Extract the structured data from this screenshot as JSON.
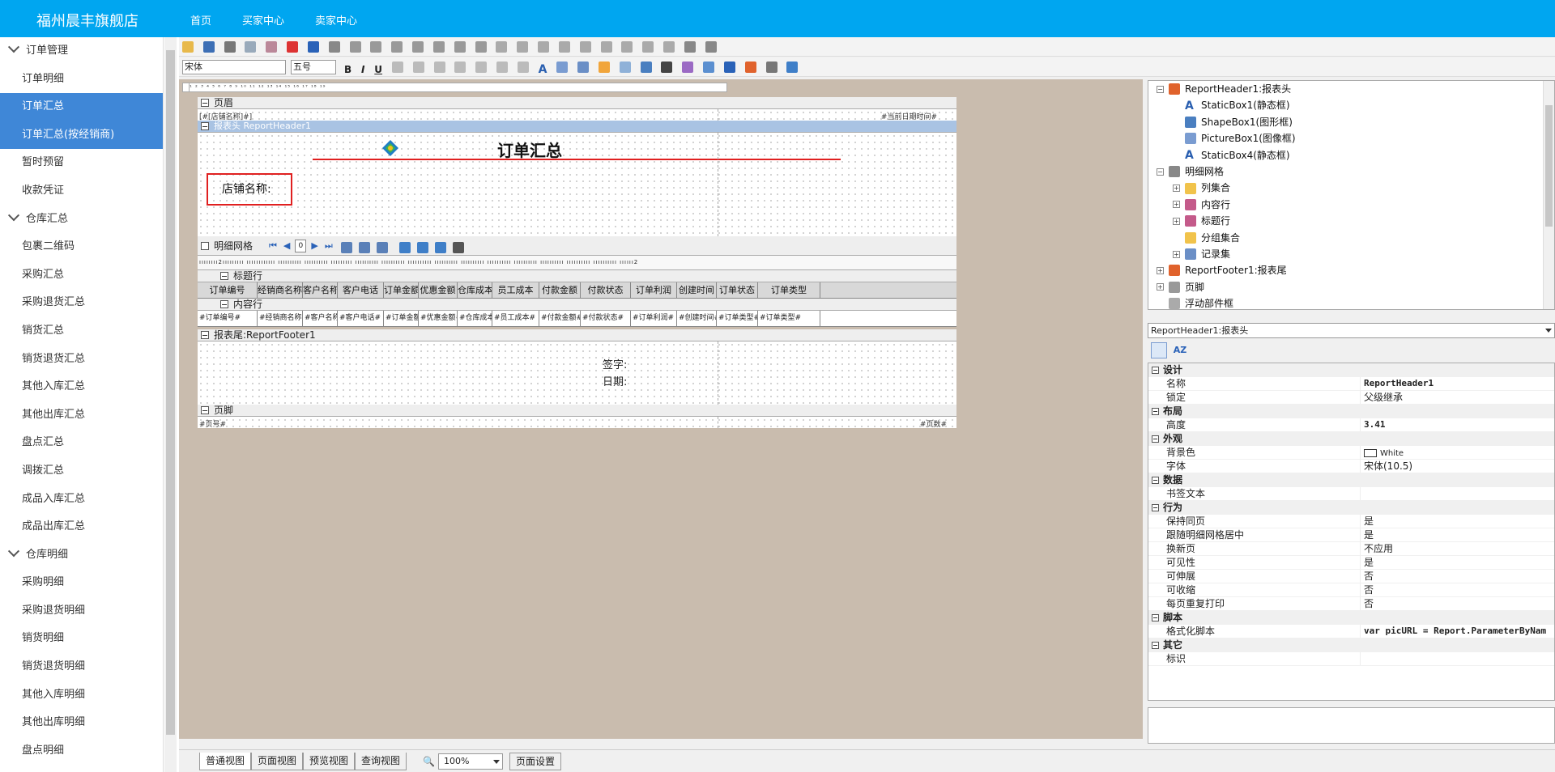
{
  "header": {
    "brand": "福州晨丰旗舰店",
    "nav": [
      "首页",
      "买家中心",
      "卖家中心"
    ]
  },
  "sidebar": {
    "items": [
      {
        "label": "订单管理",
        "group": true
      },
      {
        "label": "订单明细"
      },
      {
        "label": "订单汇总",
        "active": true
      },
      {
        "label": "订单汇总(按经销商)",
        "active": true
      },
      {
        "label": "暂时预留"
      },
      {
        "label": "收款凭证"
      },
      {
        "label": "仓库汇总",
        "group": true
      },
      {
        "label": "包裹二维码"
      },
      {
        "label": "采购汇总"
      },
      {
        "label": "采购退货汇总"
      },
      {
        "label": "销货汇总"
      },
      {
        "label": "销货退货汇总"
      },
      {
        "label": "其他入库汇总"
      },
      {
        "label": "其他出库汇总"
      },
      {
        "label": "盘点汇总"
      },
      {
        "label": "调拨汇总"
      },
      {
        "label": "成品入库汇总"
      },
      {
        "label": "成品出库汇总"
      },
      {
        "label": "仓库明细",
        "group": true
      },
      {
        "label": "采购明细"
      },
      {
        "label": "采购退货明细"
      },
      {
        "label": "销货明细"
      },
      {
        "label": "销货退货明细"
      },
      {
        "label": "其他入库明细"
      },
      {
        "label": "其他出库明细"
      },
      {
        "label": "盘点明细"
      }
    ]
  },
  "toolbar": {
    "font_name": "宋体",
    "font_size": "五号"
  },
  "report": {
    "page_header": {
      "band_label": "页眉",
      "left_field": "[#[店铺名称]#]",
      "right_field": "#当前日期时间#"
    },
    "report_header": {
      "band_label": "报表头 ReportHeader1",
      "title": "订单汇总",
      "store_label": "店铺名称:"
    },
    "detail_grid": {
      "band_label": "明细网格",
      "page_value": "0",
      "title_row_label": "标题行",
      "content_row_label": "内容行",
      "columns": [
        "订单编号",
        "经销商名称",
        "客户名称",
        "客户电话",
        "订单金额",
        "优惠金额",
        "仓库成本",
        "员工成本",
        "付款金额",
        "付款状态",
        "订单利润",
        "创建时间",
        "订单状态",
        "订单类型"
      ],
      "cells": [
        "#订单编号#",
        "#经销商名称#",
        "#客户名称#",
        "#客户电话#",
        "#订单金额#",
        "#优惠金额#",
        "#仓库成本#",
        "#员工成本#",
        "#付款金额#",
        "#付款状态#",
        "#订单利润#",
        "#创建时间#",
        "#订单类型#",
        "#订单类型#"
      ]
    },
    "report_footer": {
      "band_label": "报表尾:ReportFooter1",
      "sign_label": "签字:",
      "date_label": "日期:"
    },
    "page_footer": {
      "band_label": "页脚",
      "left_field": "#页号#",
      "right_field": "#页数#"
    },
    "ruler_text": "¹ ² ³ ⁴ ⁵ ⁶ ⁷ ⁸ ⁹ ¹⁰ ¹¹ ¹² ¹³ ¹⁴ ¹⁵ ¹⁶ ¹⁷ ¹⁸ ¹⁹"
  },
  "tree": {
    "items": [
      {
        "label": "ReportHeader1:报表头",
        "level": 0,
        "expander": "-",
        "icon": "report-header-icon"
      },
      {
        "label": "StaticBox1(静态框)",
        "level": 1,
        "icon": "static-box-icon"
      },
      {
        "label": "ShapeBox1(图形框)",
        "level": 1,
        "icon": "shape-box-icon"
      },
      {
        "label": "PictureBox1(图像框)",
        "level": 1,
        "icon": "picture-box-icon"
      },
      {
        "label": "StaticBox4(静态框)",
        "level": 1,
        "icon": "static-box-icon"
      },
      {
        "label": "明细网格",
        "level": 0,
        "expander": "-",
        "icon": "grid-icon"
      },
      {
        "label": "列集合",
        "level": 1,
        "expander": "+",
        "icon": "folder-icon"
      },
      {
        "label": "内容行",
        "level": 1,
        "expander": "+",
        "icon": "row-icon"
      },
      {
        "label": "标题行",
        "level": 1,
        "expander": "+",
        "icon": "row-icon"
      },
      {
        "label": "分组集合",
        "level": 1,
        "icon": "folder-icon"
      },
      {
        "label": "记录集",
        "level": 1,
        "expander": "+",
        "icon": "recordset-icon"
      },
      {
        "label": "ReportFooter1:报表尾",
        "level": 0,
        "expander": "+",
        "icon": "report-footer-icon"
      },
      {
        "label": "页脚",
        "level": 0,
        "expander": "+",
        "icon": "page-icon"
      },
      {
        "label": "浮动部件框",
        "level": 0,
        "icon": "float-icon"
      }
    ]
  },
  "object_selector": "ReportHeader1:报表头",
  "properties": [
    {
      "key": "设计",
      "cat": true
    },
    {
      "key": "名称",
      "value": "ReportHeader1",
      "bold": true
    },
    {
      "key": "锁定",
      "value": "父级继承"
    },
    {
      "key": "布局",
      "cat": true
    },
    {
      "key": "高度",
      "value": "3.41",
      "bold": true
    },
    {
      "key": "外观",
      "cat": true
    },
    {
      "key": "背景色",
      "value": "White",
      "swatch": "#ffffff"
    },
    {
      "key": "字体",
      "value": "宋体(10.5)"
    },
    {
      "key": "数据",
      "cat": true
    },
    {
      "key": "书签文本",
      "value": ""
    },
    {
      "key": "行为",
      "cat": true
    },
    {
      "key": "保持同页",
      "value": "是"
    },
    {
      "key": "跟随明细网格居中",
      "value": "是"
    },
    {
      "key": "换新页",
      "value": "不应用"
    },
    {
      "key": "可见性",
      "value": "是"
    },
    {
      "key": "可伸展",
      "value": "否"
    },
    {
      "key": "可收缩",
      "value": "否"
    },
    {
      "key": "每页重复打印",
      "value": "否"
    },
    {
      "key": "脚本",
      "cat": true
    },
    {
      "key": "格式化脚本",
      "value": "var picURL = Report.ParameterByNam",
      "bold": true
    },
    {
      "key": "其它",
      "cat": true
    },
    {
      "key": "标识",
      "value": ""
    }
  ],
  "bottom_tabs": [
    "普通视图",
    "页面视图",
    "预览视图",
    "查询视图"
  ],
  "zoom": "100%",
  "page_setup": "页面设置",
  "colors": {
    "topbar": "#00a6f0",
    "sidebar_active": "#3f87d7",
    "canvas_bg": "#c9bcae",
    "title_underline": "#e02020",
    "store_box": "#e02020"
  }
}
